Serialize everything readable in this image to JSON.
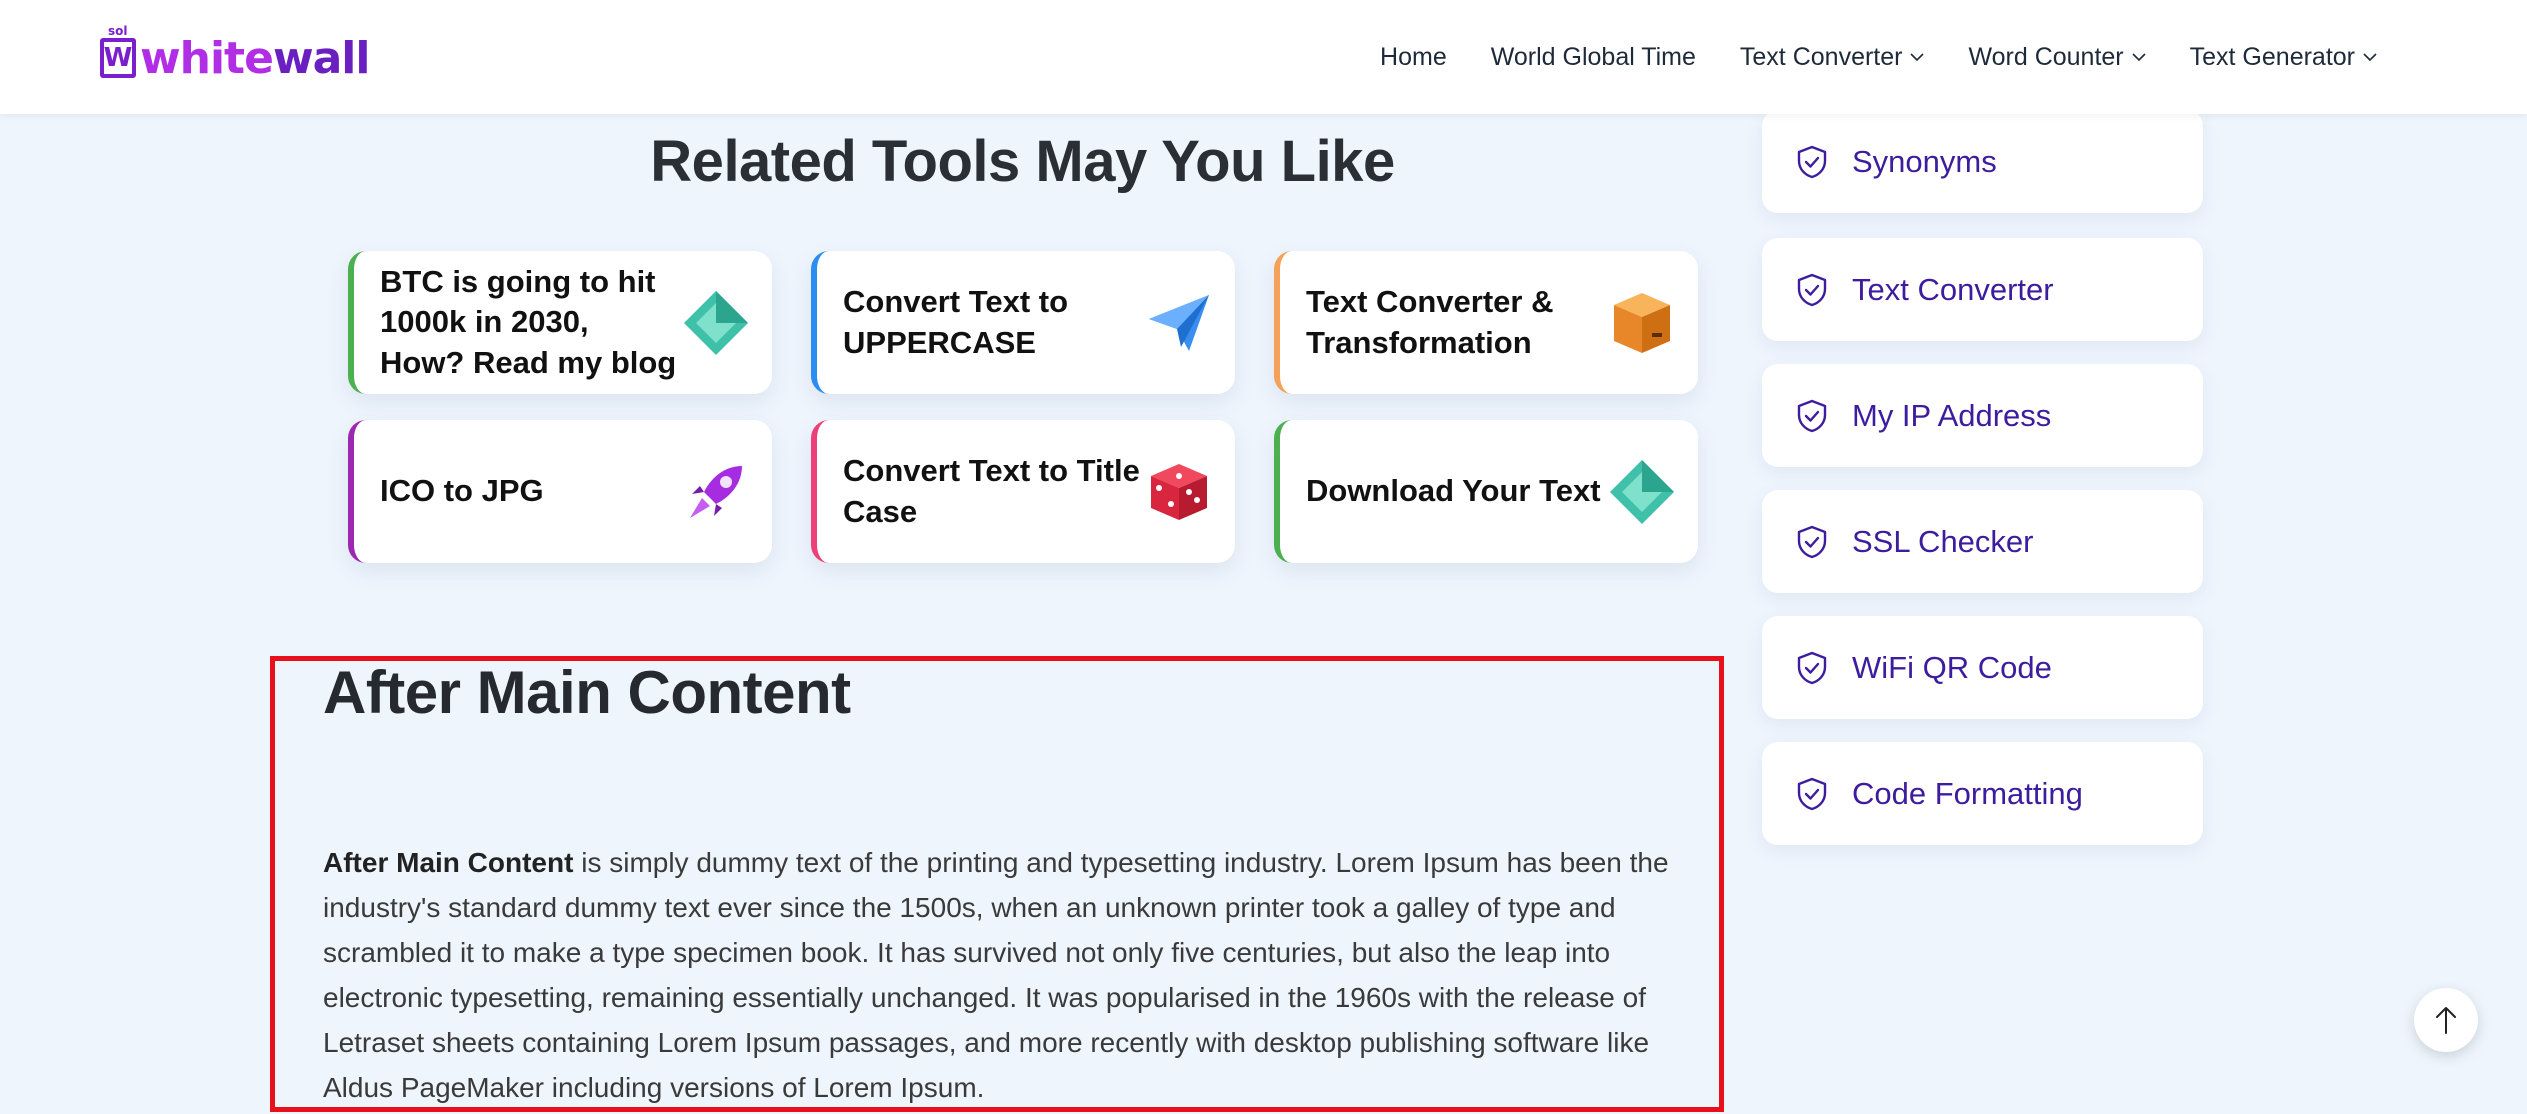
{
  "header": {
    "logo": {
      "sol": "sol",
      "mark": "W",
      "white": "white",
      "wall": "wall"
    },
    "nav": [
      {
        "label": "Home",
        "dropdown": false
      },
      {
        "label": "World Global Time",
        "dropdown": false
      },
      {
        "label": "Text Converter",
        "dropdown": true
      },
      {
        "label": "Word Counter",
        "dropdown": true
      },
      {
        "label": "Text Generator",
        "dropdown": true
      }
    ]
  },
  "related": {
    "title": "Related Tools May You Like",
    "cards": [
      {
        "label": "BTC is going to hit 1000k in 2030, How? Read my blog",
        "icon": "gem-icon",
        "accent": "#4caf50"
      },
      {
        "label": "Convert Text to UPPERCASE",
        "icon": "paper-plane-icon",
        "accent": "#2b8df0"
      },
      {
        "label": "Text Converter & Transformation",
        "icon": "box-icon",
        "accent": "#f5a15a"
      },
      {
        "label": "ICO to JPG",
        "icon": "rocket-icon",
        "accent": "#9c27b0"
      },
      {
        "label": "Convert Text to Title Case",
        "icon": "dice-icon",
        "accent": "#ec407a"
      },
      {
        "label": "Download Your Text",
        "icon": "gem-icon",
        "accent": "#4caf50"
      }
    ]
  },
  "after": {
    "title": "After Main Content",
    "lead": "After Main Content",
    "body": " is simply dummy text of the printing and typesetting industry. Lorem Ipsum has been the industry's standard dummy text ever since the 1500s, when an unknown printer took a galley of type and scrambled it to make a type specimen book. It has survived not only five centuries, but also the leap into electronic typesetting, remaining essentially unchanged. It was popularised in the 1960s with the release of Letraset sheets containing Lorem Ipsum passages, and more recently with desktop publishing software like Aldus PageMaker including versions of Lorem Ipsum."
  },
  "sidebar": {
    "items": [
      {
        "label": "Synonyms"
      },
      {
        "label": "Text Converter"
      },
      {
        "label": "My IP Address"
      },
      {
        "label": "SSL Checker"
      },
      {
        "label": "WiFi QR Code"
      },
      {
        "label": "Code Formatting"
      }
    ]
  },
  "colors": {
    "accent_highlight": "#e8101a",
    "sidebar_text": "#3d1c9e",
    "logo_white": "#b12ee6",
    "logo_wall": "#6a1fc1"
  }
}
